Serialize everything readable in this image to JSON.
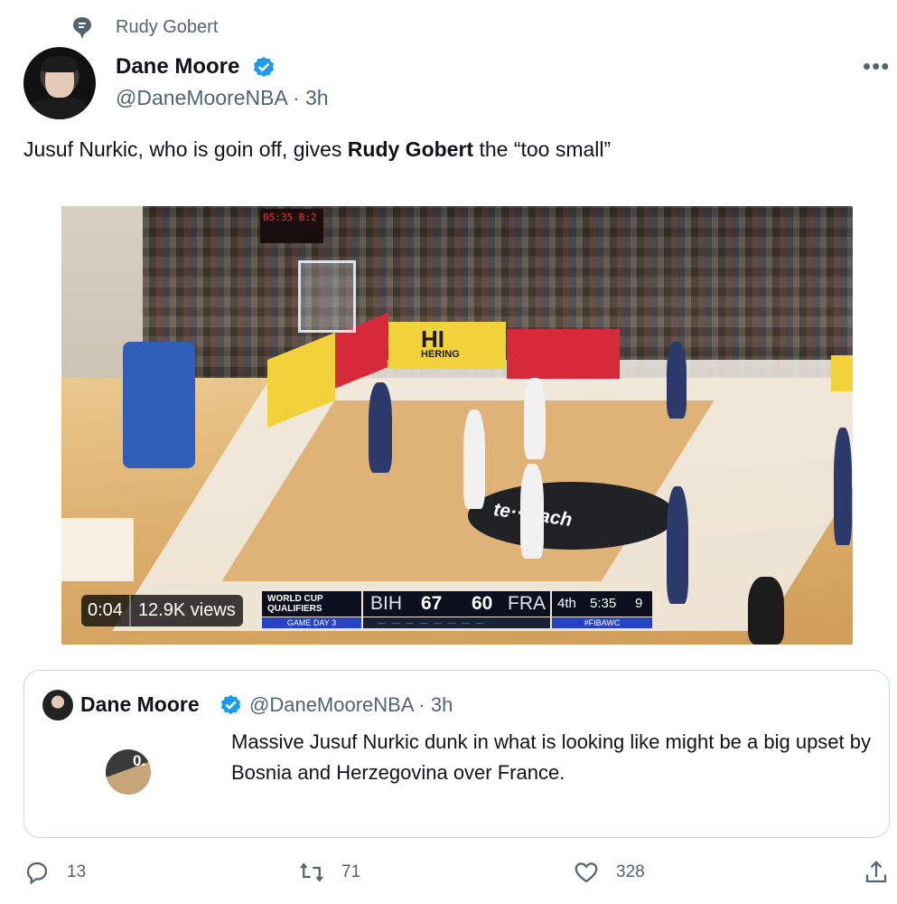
{
  "social_context": {
    "label": "Rudy Gobert",
    "icon": "topic-icon"
  },
  "author": {
    "name": "Dane Moore",
    "handle": "@DaneMooreNBA · 3h",
    "verified": true
  },
  "tweet": {
    "text_before": "Jusuf Nurkic, who is goin off, gives ",
    "text_bold": "Rudy Gobert",
    "text_after": " the “too small”"
  },
  "video": {
    "time": "0:04",
    "views": "12.9K views",
    "scoreboard": {
      "event_line1": "WORLD CUP",
      "event_line2": "QUALIFIERS",
      "game_day": "GAME DAY 3",
      "team1": "BIH",
      "score1": "67",
      "score2": "60",
      "team2": "FRA",
      "quarter": "4th",
      "clock": "5:35",
      "shot_clock": "9",
      "hashtag": "#FIBAWC",
      "dashes": "— — — —   — — — —"
    },
    "arena": {
      "board_text": "HI",
      "board_sub": "HERING",
      "floor_text": "te··mach",
      "shotclock_text": "05:35 B:2"
    }
  },
  "quote": {
    "name": "Dane Moore",
    "handle": "@DaneMooreNBA · 3h",
    "text": "Massive Jusuf Nurkic dunk in what is looking like might be a big upset by Bosnia and Herzegovina over France.",
    "thumb_text": "0."
  },
  "actions": {
    "replies": "13",
    "retweets": "71",
    "likes": "328"
  },
  "colors": {
    "accent": "#1d9bf0",
    "muted": "#536471",
    "text": "#0f1419",
    "border": "#cfd9de"
  }
}
